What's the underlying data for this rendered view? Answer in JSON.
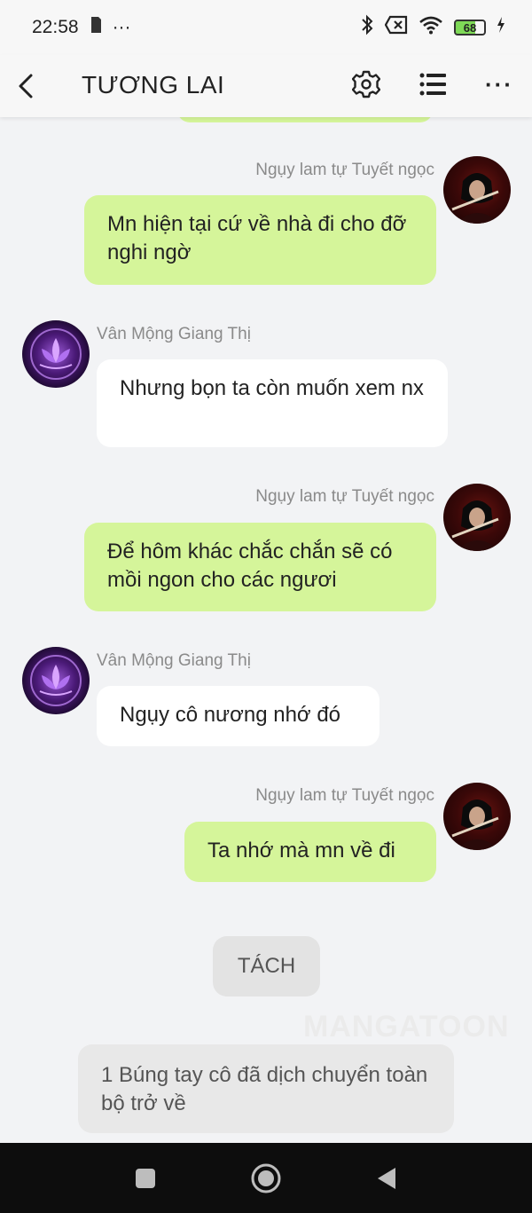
{
  "status_bar": {
    "time": "22:58",
    "dots": "···",
    "battery_level": "68"
  },
  "header": {
    "title": "TƯƠNG LAI",
    "icons": [
      "back-icon",
      "gear-icon",
      "list-icon",
      "more-icon"
    ],
    "more_glyph": "···"
  },
  "messages": [
    {
      "side": "right",
      "sender": "Ngụy lam tự Tuyết ngọc",
      "text": "Mn hiện tại cứ về nhà đi cho đỡ nghi ngờ",
      "avatar": "red-warrior"
    },
    {
      "side": "left",
      "sender": "Vân Mộng Giang Thị",
      "text": "Nhưng bọn ta còn muốn xem nx",
      "avatar": "purple-lotus"
    },
    {
      "side": "right",
      "sender": "Ngụy lam tự Tuyết ngọc",
      "text": "Để hôm khác chắc chắn sẽ có mồi ngon cho các ngươi",
      "avatar": "red-warrior"
    },
    {
      "side": "left",
      "sender": "Vân Mộng Giang Thị",
      "text": "Ngụy cô nương nhớ đó",
      "avatar": "purple-lotus"
    },
    {
      "side": "right",
      "sender": "Ngụy lam tự Tuyết ngọc",
      "text": "Ta nhớ mà mn về đi",
      "avatar": "red-warrior"
    }
  ],
  "tach_label": "TÁCH",
  "watermark": "MANGATOON",
  "narration": "1 Búng tay cô đã dịch chuyển toàn bộ trở về",
  "colors": {
    "bubble_green": "#d5f59a",
    "bubble_white": "#ffffff",
    "background": "#f2f3f5"
  }
}
